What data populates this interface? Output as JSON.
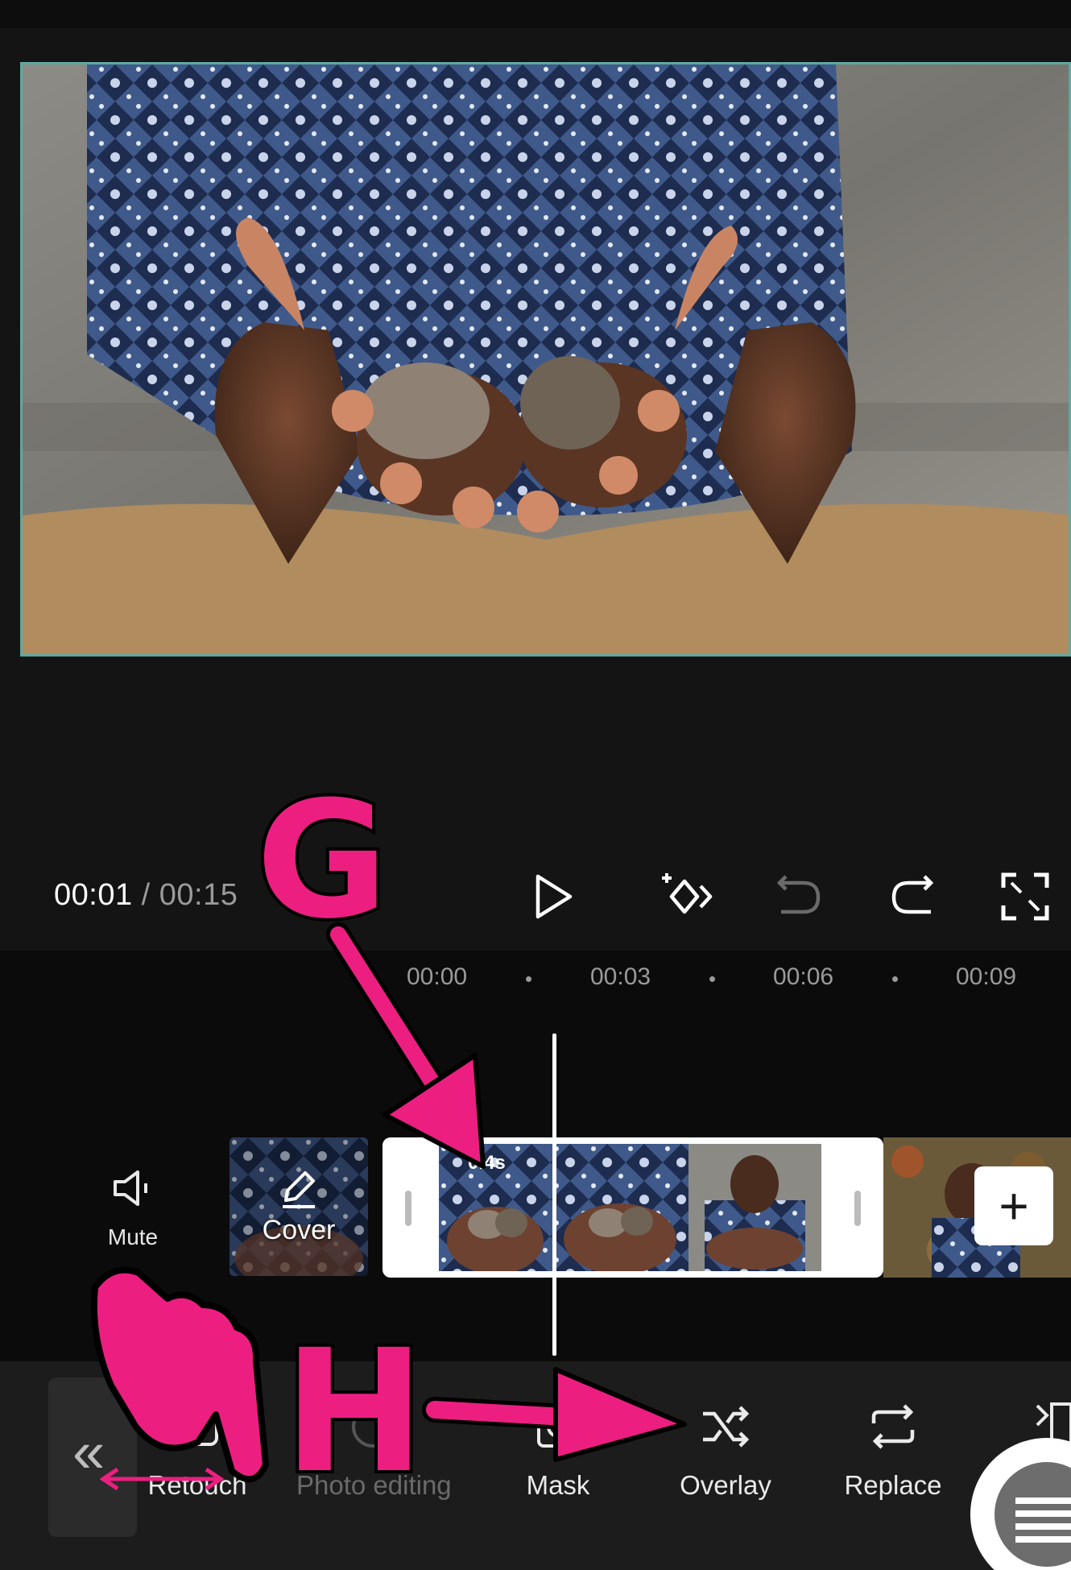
{
  "player": {
    "current_time": "00:01",
    "separator": "/",
    "total_time": "00:15"
  },
  "ruler": {
    "labels": [
      "00:00",
      "00:03",
      "00:06",
      "00:09"
    ]
  },
  "track": {
    "mute_label": "Mute",
    "cover_label": "Cover",
    "clip_overlay_text": "0.4s"
  },
  "toolbar": {
    "items": [
      {
        "label": "Retouch",
        "icon": "retouch-icon",
        "enabled": true
      },
      {
        "label": "Photo editing",
        "icon": "photo-editing-icon",
        "enabled": false
      },
      {
        "label": "Mask",
        "icon": "mask-icon",
        "enabled": true
      },
      {
        "label": "Overlay",
        "icon": "shuffle-icon",
        "enabled": true
      },
      {
        "label": "Replace",
        "icon": "replace-icon",
        "enabled": true
      }
    ]
  },
  "annotations": {
    "letter_g": "G",
    "letter_h": "H",
    "color": "#ec1f81"
  },
  "colors": {
    "accent_border": "#5fa8a0",
    "background": "#141414",
    "timeline_bg": "#0b0b0b",
    "toolbar_bg": "#1c1c1c"
  }
}
